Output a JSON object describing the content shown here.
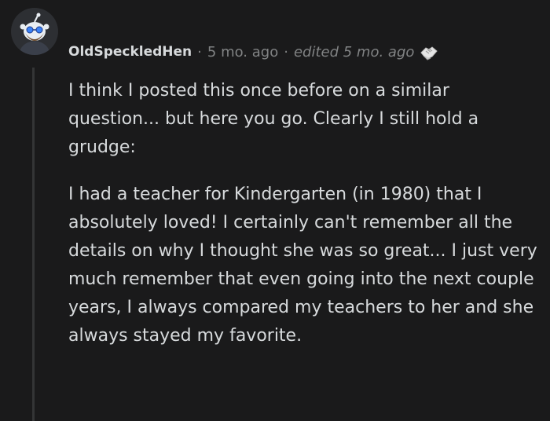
{
  "comment": {
    "author": "OldSpeckledHen",
    "separator": "·",
    "time_ago": "5 mo. ago",
    "edited_label": "edited 5 mo. ago",
    "avatar_icon": "user-avatar-icon",
    "award_icon": "handshake-award-icon",
    "paragraphs": [
      "I think I posted this once before on a similar question... but here you go. Clearly I still hold a grudge:",
      "I had a teacher for Kindergarten (in 1980) that I absolutely loved! I certainly can't remember all the details on why I thought she was so great... I just very much remember that even going into the next couple years, I always compared my teachers to her and she always stayed my favorite."
    ]
  },
  "colors": {
    "background": "#1a1a1b",
    "text": "#d7dadc",
    "muted": "#818384",
    "thread_line": "#343536"
  }
}
